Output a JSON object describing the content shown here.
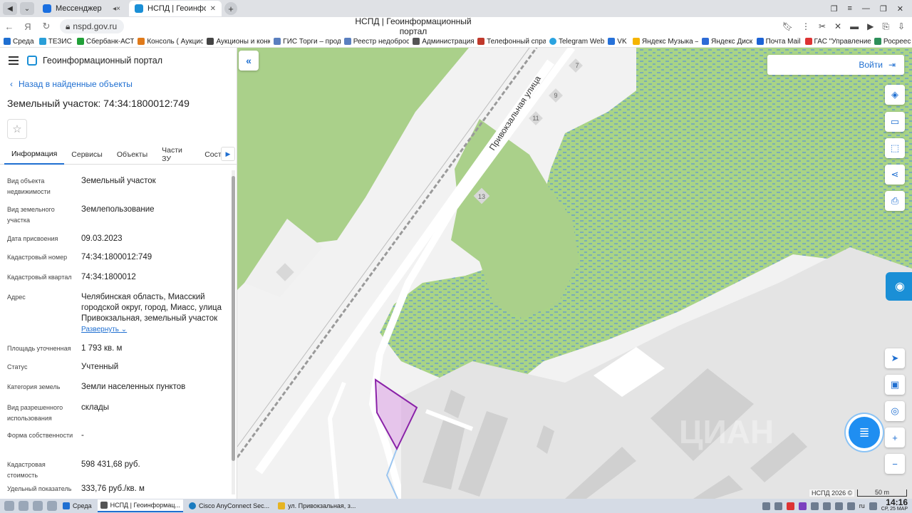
{
  "browser": {
    "tabs": [
      {
        "label": "Мессенджер",
        "active": false
      },
      {
        "label": "НСПД | Геоинформац...",
        "active": true
      }
    ],
    "address": "nspd.gov.ru",
    "page_title": "НСПД | Геоинформационный портал",
    "bookmarks": [
      "Среда",
      "ТЕЗИС",
      "Сбербанк-АСТ",
      "Консоль ( Аукцио",
      "Аукционы и конк",
      "ГИС Торги – прод",
      "Реестр недоброс",
      "Администрация",
      "Телефонный спра",
      "Telegram Web",
      "VK",
      "Яндекс Музыка –",
      "Яндекс Диск",
      "Почта Mail",
      "ГАС \"Управление",
      "Росреес"
    ]
  },
  "panel": {
    "portal_name": "Геоинформационный портал",
    "back_label": "Назад в найденные объекты",
    "title": "Земельный участок: 74:34:1800012:749",
    "tabs": [
      "Информация",
      "Сервисы",
      "Объекты",
      "Части ЗУ",
      "Состав"
    ],
    "properties": [
      {
        "label": "Вид объекта недвижимости",
        "value": "Земельный участок"
      },
      {
        "label": "Вид земельного участка",
        "value": "Землепользование"
      },
      {
        "label": "Дата присвоения",
        "value": "09.03.2023"
      },
      {
        "label": "Кадастровый номер",
        "value": "74:34:1800012:749"
      },
      {
        "label": "Кадастровый квартал",
        "value": "74:34:1800012"
      },
      {
        "label": "Адрес",
        "value": "Челябинская область, Миасский городской округ, город, Миасс, улица Привокзальная, земельный участок"
      },
      {
        "label": "Площадь уточненная",
        "value": "1 793 кв. м"
      },
      {
        "label": "Статус",
        "value": "Учтенный"
      },
      {
        "label": "Категория земель",
        "value": "Земли населенных пунктов"
      },
      {
        "label": "Вид разрешенного использования",
        "value": "склады"
      },
      {
        "label": "Форма собственности",
        "value": "-"
      },
      {
        "label": "Кадастровая стоимость",
        "value": "598 431,68 руб."
      },
      {
        "label": "Удельный показатель",
        "value": "333,76 руб./кв. м"
      }
    ],
    "expand_label": "Развернуть"
  },
  "map": {
    "street_label": "Привокзальная улица",
    "house_numbers": [
      "7",
      "9",
      "11",
      "13"
    ],
    "login_label": "Войти",
    "copyright": "НСПД 2026 ©",
    "scale": "50 m",
    "watermark": "ЦИАН"
  },
  "taskbar": {
    "tasks": [
      "Среда",
      "НСПД | Геоинформац...",
      "Cisco AnyConnect Sec...",
      "ул. Привокзальная, з..."
    ],
    "time": "14:16",
    "date": "СР, 25 МАР",
    "lang": "ru"
  }
}
